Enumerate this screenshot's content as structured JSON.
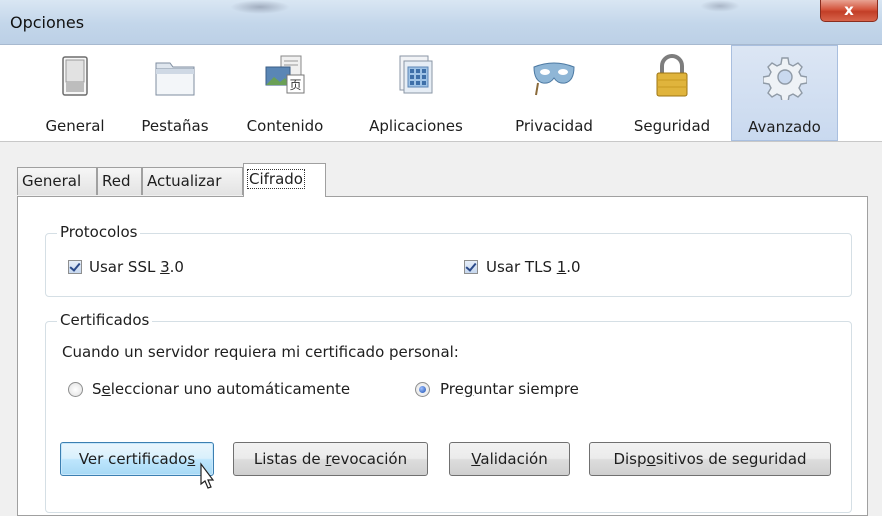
{
  "window": {
    "title": "Opciones",
    "close_glyph": "x"
  },
  "categories": [
    {
      "label": "General",
      "icon": "switch-icon",
      "selected": false
    },
    {
      "label": "Pestañas",
      "icon": "folder-tabs-icon",
      "selected": false
    },
    {
      "label": "Contenido",
      "icon": "content-icon",
      "selected": false
    },
    {
      "label": "Aplicaciones",
      "icon": "applications-icon",
      "selected": false
    },
    {
      "label": "Privacidad",
      "icon": "mask-icon",
      "selected": false
    },
    {
      "label": "Seguridad",
      "icon": "padlock-icon",
      "selected": false
    },
    {
      "label": "Avanzado",
      "icon": "gear-icon",
      "selected": true
    }
  ],
  "tabs": [
    {
      "label": "General",
      "active": false
    },
    {
      "label": "Red",
      "active": false
    },
    {
      "label": "Actualizar",
      "active": false
    },
    {
      "label": "Cifrado",
      "active": true
    }
  ],
  "protocols": {
    "title": "Protocolos",
    "ssl": {
      "pre": "Usar SSL ",
      "key": "3",
      "post": ".0",
      "checked": true
    },
    "tls": {
      "pre": "Usar TLS ",
      "key": "1",
      "post": ".0",
      "checked": true
    }
  },
  "certificates": {
    "title": "Certificados",
    "prompt": "Cuando un servidor requiera mi certificado personal:",
    "auto": {
      "pre": "S",
      "key": "e",
      "post": "leccionar uno automáticamente",
      "selected": false
    },
    "ask": {
      "pre": "Pre",
      "key": "g",
      "post": "untar siempre",
      "selected": true
    }
  },
  "buttons": {
    "view": {
      "pre": "Ver certificado",
      "key": "s",
      "post": ""
    },
    "revocation": {
      "pre": "Listas de ",
      "key": "r",
      "post": "evocación"
    },
    "validation": {
      "pre": "",
      "key": "V",
      "post": "alidación"
    },
    "devices": {
      "pre": "Disp",
      "key": "o",
      "post": "sitivos de seguridad"
    }
  },
  "colors": {
    "selected_category": "#c9d9ef",
    "close_button": "#c23e27",
    "focused_button": "#bee6fd"
  }
}
